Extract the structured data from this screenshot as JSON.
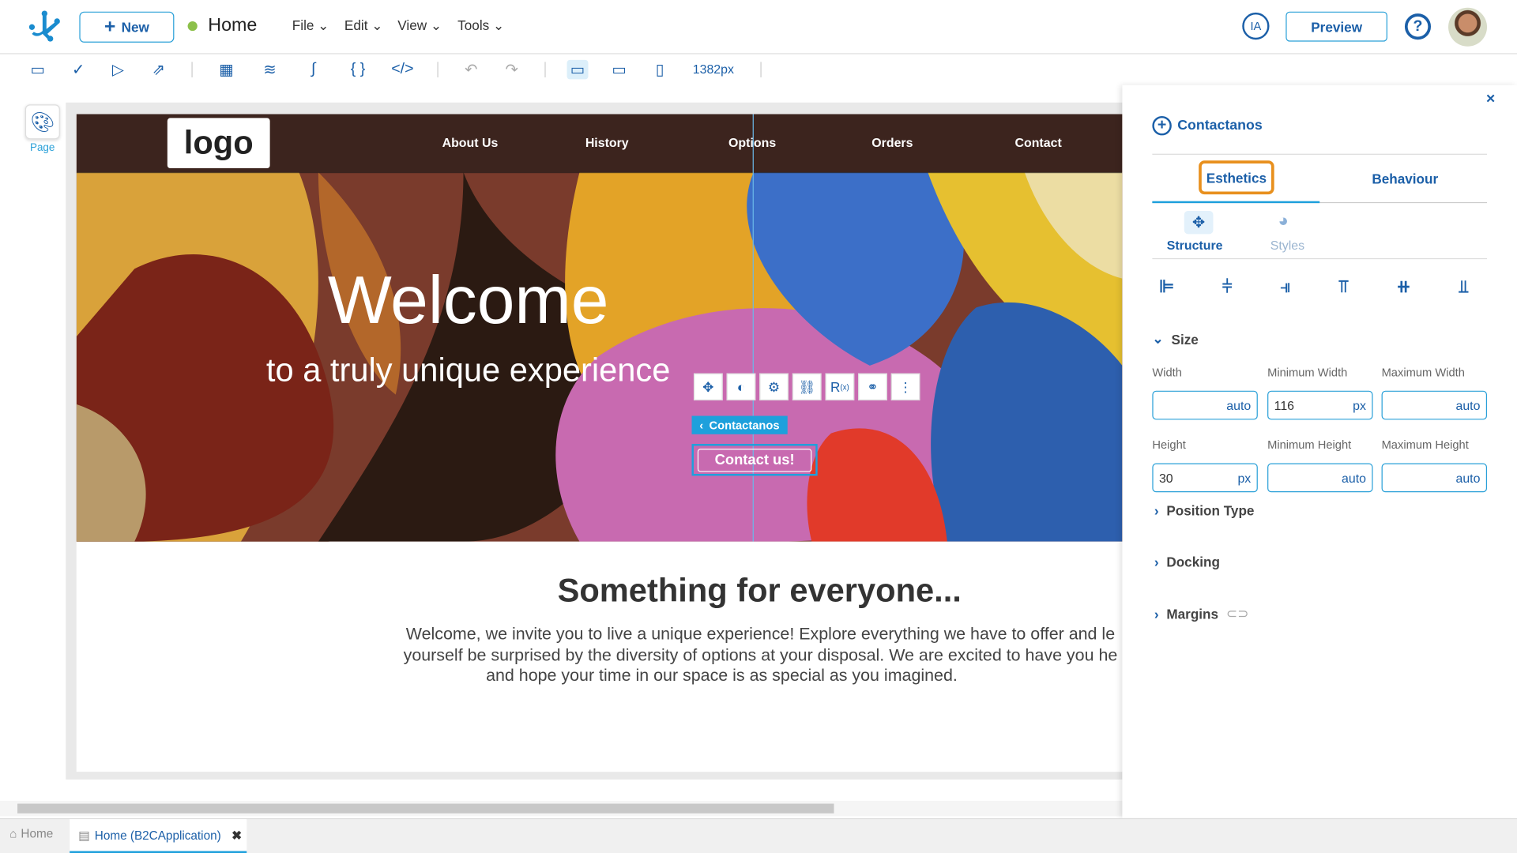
{
  "header": {
    "new_label": "New",
    "page_title": "Home",
    "menus": [
      "File",
      "Edit",
      "View",
      "Tools"
    ],
    "ia_label": "IA",
    "preview_label": "Preview",
    "help": "?"
  },
  "toolbar": {
    "width_readout": "1382px"
  },
  "left_rail": {
    "page_label": "Page"
  },
  "site": {
    "logo": "logo",
    "nav": [
      "About Us",
      "History",
      "Options",
      "Orders",
      "Contact"
    ],
    "hero_title": "Welcome",
    "hero_subtitle": "to a truly unique experience",
    "selected_tag": "Contactanos",
    "cta": "Contact us!",
    "section_title": "Something for everyone...",
    "paragraph_lines": [
      "Welcome, we invite you to live a unique experience! Explore everything we have to offer and le",
      "yourself be surprised by the diversity of options at your disposal. We are excited to have you he",
      "and hope your time in our space is as special as you imagined."
    ]
  },
  "panel": {
    "close": "×",
    "component_name": "Contactanos",
    "tabs": [
      "Esthetics",
      "Behaviour"
    ],
    "subtabs": [
      "Structure",
      "Styles"
    ],
    "size_title": "Size",
    "fields": [
      {
        "label": "Width",
        "value": "",
        "unit": "auto"
      },
      {
        "label": "Minimum Width",
        "value": "116",
        "unit": "px"
      },
      {
        "label": "Maximum Width",
        "value": "",
        "unit": "auto"
      },
      {
        "label": "Height",
        "value": "30",
        "unit": "px"
      },
      {
        "label": "Minimum Height",
        "value": "",
        "unit": "auto"
      },
      {
        "label": "Maximum Height",
        "value": "",
        "unit": "auto"
      }
    ],
    "sections": [
      "Position Type",
      "Docking",
      "Margins"
    ]
  },
  "bottom_tabs": [
    "Home",
    "Home (B2CApplication)"
  ],
  "colors": {
    "accent": "#1b5fa8",
    "highlight": "#2aa0d8",
    "focus_outline": "#e8901e",
    "status_dot": "#8cc04a"
  }
}
